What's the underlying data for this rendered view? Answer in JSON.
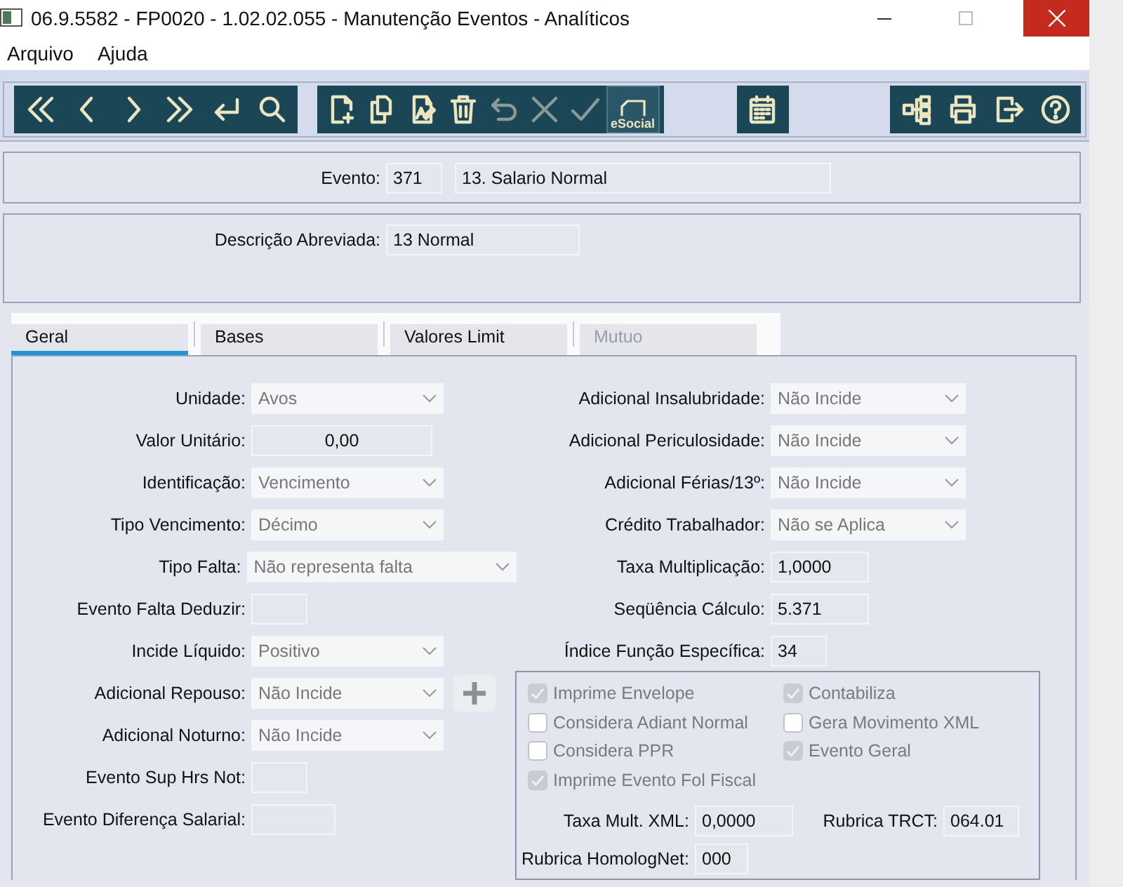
{
  "window": {
    "title": "06.9.5582 - FP0020 - 1.02.02.055 - Manutenção Eventos - Analíticos"
  },
  "menu": [
    "Arquivo",
    "Ajuda"
  ],
  "toolbar": [
    [
      {
        "kind": "first",
        "disabled": false
      },
      {
        "kind": "prev",
        "disabled": false
      },
      {
        "kind": "next",
        "disabled": false
      },
      {
        "kind": "last",
        "disabled": false
      },
      {
        "kind": "enter",
        "disabled": false
      },
      {
        "kind": "search",
        "disabled": false
      }
    ],
    [
      {
        "kind": "new",
        "disabled": false
      },
      {
        "kind": "copy",
        "disabled": false
      },
      {
        "kind": "edit",
        "disabled": false
      },
      {
        "kind": "delete",
        "disabled": false
      },
      {
        "kind": "undo",
        "disabled": true
      },
      {
        "kind": "cancel",
        "disabled": true
      },
      {
        "kind": "confirm",
        "disabled": true
      },
      {
        "kind": "esocial",
        "label": "eSocial",
        "disabled": false
      }
    ],
    [
      {
        "kind": "calendar",
        "disabled": false
      }
    ],
    [
      {
        "kind": "tree",
        "disabled": false
      },
      {
        "kind": "print",
        "disabled": false
      },
      {
        "kind": "exit",
        "disabled": false
      },
      {
        "kind": "help",
        "disabled": false
      }
    ]
  ],
  "evento": {
    "label": "Evento:",
    "code": "371",
    "name": "13. Salario Normal"
  },
  "descricao": {
    "label": "Descrição Abreviada:",
    "value": "13 Normal"
  },
  "tabs": [
    {
      "label": "Geral",
      "selected": true,
      "disabled": false
    },
    {
      "label": "Bases",
      "selected": false,
      "disabled": false
    },
    {
      "label": "Valores Limit",
      "selected": false,
      "disabled": false
    },
    {
      "label": "Mutuo",
      "selected": false,
      "disabled": true
    }
  ],
  "left_fields": [
    {
      "label": "Unidade:",
      "kind": "select",
      "value": "Avos"
    },
    {
      "label": "Valor Unitário:",
      "kind": "amount",
      "value": "0,00"
    },
    {
      "label": "Identificação:",
      "kind": "select",
      "value": "Vencimento"
    },
    {
      "label": "Tipo Vencimento:",
      "kind": "select",
      "value": "Décimo"
    },
    {
      "label": "Tipo Falta:",
      "kind": "select",
      "value": "Não representa falta"
    },
    {
      "label": "Evento Falta Deduzir:",
      "kind": "text"
    },
    {
      "label": "Incide Líquido:",
      "kind": "select",
      "value": "Positivo"
    },
    {
      "label": "Adicional Repouso:",
      "kind": "select",
      "value": "Não Incide",
      "add_button": true
    },
    {
      "label": "Adicional Noturno:",
      "kind": "select",
      "value": "Não Incide"
    },
    {
      "label": "Evento Sup Hrs Not:",
      "kind": "text"
    },
    {
      "label": "Evento Diferença Salarial:",
      "kind": "text"
    }
  ],
  "right_fields": [
    {
      "label": "Adicional Insalubridade:",
      "kind": "select",
      "value": "Não Incide"
    },
    {
      "label": "Adicional Periculosidade:",
      "kind": "select",
      "value": "Não Incide"
    },
    {
      "label": "Adicional Férias/13º:",
      "kind": "select",
      "value": "Não Incide"
    },
    {
      "label": "Crédito Trabalhador:",
      "kind": "select",
      "value": "Não se Aplica"
    },
    {
      "label": "Taxa Multiplicação:",
      "kind": "text",
      "value": "1,0000"
    },
    {
      "label": "Seqüência Cálculo:",
      "kind": "text",
      "value": "5.371"
    },
    {
      "label": "Índice Função Específica:",
      "kind": "text",
      "value": "34"
    }
  ],
  "checkbox_columns": [
    [
      {
        "label": "Imprime Envelope",
        "checked": true
      },
      {
        "label": "Considera Adiant Normal",
        "checked": false
      },
      {
        "label": "Considera PPR",
        "checked": false
      },
      {
        "label": "Imprime Evento Fol Fiscal",
        "checked": true
      }
    ],
    [
      {
        "label": "Contabiliza",
        "checked": true
      },
      {
        "label": "Gera Movimento XML",
        "checked": false
      },
      {
        "label": "Evento Geral",
        "checked": true
      }
    ]
  ],
  "taxa_mult_xml": {
    "label": "Taxa Mult. XML:",
    "value": "0,0000"
  },
  "rubrica_trct": {
    "label": "Rubrica TRCT:",
    "value": "064.01"
  },
  "rubrica_homolognet": {
    "label": "Rubrica HomologNet:",
    "value": "000"
  }
}
